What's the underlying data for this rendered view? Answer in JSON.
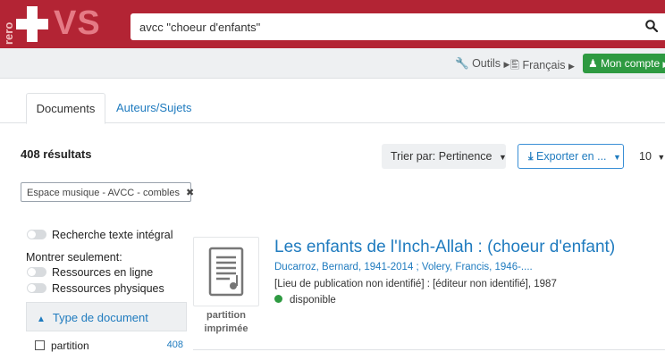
{
  "header": {
    "logo_side_text": "rero",
    "logo_text": "VS",
    "search_value": "avcc \"choeur d'enfants\""
  },
  "topnav": {
    "tools_label": "Outils",
    "language_label": "Français",
    "account_label": "Mon compte"
  },
  "tabs": [
    {
      "label": "Documents"
    },
    {
      "label": "Auteurs/Sujets"
    }
  ],
  "results": {
    "count_label": "408 résultats",
    "sort_label": "Trier par: Pertinence",
    "export_label": "Exporter en ...",
    "per_page": "10"
  },
  "active_filter": {
    "label": "Espace musique - AVCC - combles"
  },
  "sidebar": {
    "fulltext_label": "Recherche texte intégral",
    "show_only_label": "Montrer seulement:",
    "online_label": "Ressources en ligne",
    "physical_label": "Ressources physiques",
    "facet_title": "Type de document",
    "facet_items": [
      {
        "label": "partition",
        "count": "408"
      }
    ]
  },
  "result_item": {
    "type_label": "partition imprimée",
    "title": "Les enfants de l'Inch-Allah : (choeur d'enfant)",
    "authors": "Ducarroz, Bernard, 1941-2014 ; Volery, Francis, 1946-....",
    "publication": "[Lieu de publication non identifié] : [éditeur non identifié], 1987",
    "availability": "disponible"
  },
  "colors": {
    "brand_red": "#b32434",
    "link_blue": "#1f7bbf",
    "success_green": "#2e9a41"
  }
}
